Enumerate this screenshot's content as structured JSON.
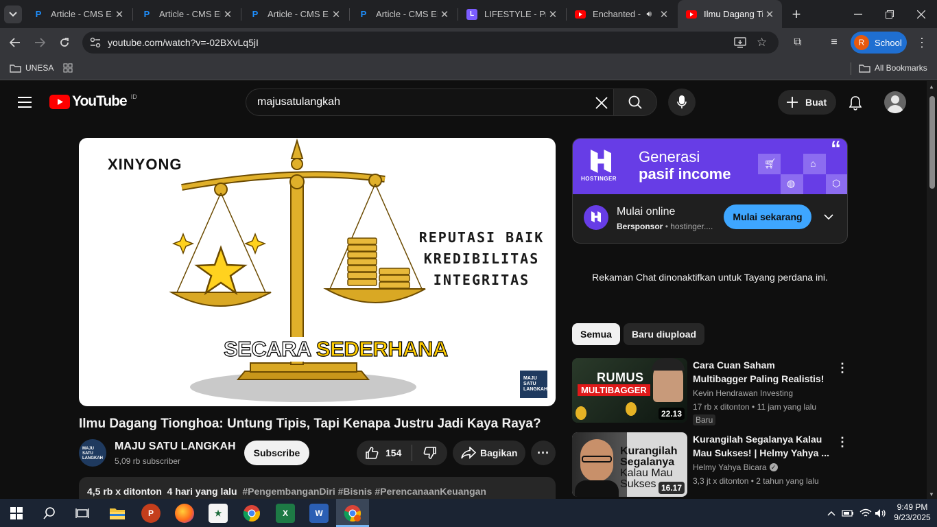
{
  "browser": {
    "tabs": [
      {
        "title": "Article - CMS EDITOR",
        "icon": "P"
      },
      {
        "title": "Article - CMS EDITOR",
        "icon": "P"
      },
      {
        "title": "Article - CMS EDITOR",
        "icon": "P"
      },
      {
        "title": "Article - CMS EDITOR",
        "icon": "P"
      },
      {
        "title": "LIFESTYLE - Press",
        "icon": "L"
      },
      {
        "title": "Enchanted - ",
        "icon": "Y"
      },
      {
        "title": "Ilmu Dagang Tionghoa",
        "icon": "Y"
      }
    ],
    "url": "youtube.com/watch?v=-02BXvLq5jI",
    "profile_label": "School",
    "profile_initial": "R",
    "bookmarks": {
      "folder": "UNESA",
      "all": "All Bookmarks"
    }
  },
  "youtube": {
    "logo_text": "YouTube",
    "region": "ID",
    "search_value": "majusatulangkah",
    "create_label": "Buat",
    "video": {
      "thumb_text_top": "XINYONG",
      "thumb_text_right": [
        "REPUTASI BAIK",
        "KREDIBILITAS",
        "INTEGRITAS"
      ],
      "thumb_text_bottom_1": "SECARA",
      "thumb_text_bottom_2": "SEDERHANA",
      "thumb_badge": "MAJU SATU LANGKAH",
      "title": "Ilmu Dagang Tionghoa: Untung Tipis, Tapi Kenapa Justru Jadi Kaya Raya?",
      "channel": "MAJU SATU LANGKAH",
      "subscribers": "5,09 rb subscriber",
      "subscribe_label": "Subscribe",
      "likes": "154",
      "share_label": "Bagikan",
      "views": "4,5 rb x ditonton",
      "date": "4 hari yang lalu",
      "hashtags": "#PengembanganDiri #Bisnis #PerencanaanKeuangan"
    },
    "ad": {
      "brand": "HOSTINGER",
      "headline_1": "Generasi",
      "headline_2": "pasif income",
      "title": "Mulai online",
      "sponsored": "Bersponsor",
      "domain": "hostinger....",
      "cta": "Mulai sekarang"
    },
    "chat_notice": "Rekaman Chat dinonaktifkan untuk Tayang perdana ini.",
    "chips": [
      "Semua",
      "Baru diupload"
    ],
    "recommendations": [
      {
        "title": "Cara Cuan Saham Multibagger Paling Realistis!",
        "channel": "Kevin Hendrawan Investing",
        "meta": "17 rb x ditonton • 11 jam yang lalu",
        "badge": "Baru",
        "duration": "22.13",
        "thumb_line_1": "RUMUS",
        "thumb_line_2": "MULTIBAGGER",
        "verified": false
      },
      {
        "title": "Kurangilah Segalanya Kalau Mau Sukses! | Helmy Yahya ...",
        "channel": "Helmy Yahya Bicara",
        "meta": "3,3 jt x ditonton • 2 tahun yang lalu",
        "badge": "",
        "duration": "16.17",
        "thumb_line_1": "Kurangilah",
        "thumb_line_2": "Segalanya",
        "thumb_line_3": "Kalau Mau",
        "thumb_line_4": "Sukses",
        "verified": true
      }
    ]
  },
  "taskbar": {
    "time": "9:49 PM",
    "date": "9/23/2025"
  },
  "colors": {
    "yt_red": "#ff0000",
    "ad_purple": "#673de6",
    "ad_button": "#3ea6ff",
    "thumb_gold": "#d4a017"
  }
}
